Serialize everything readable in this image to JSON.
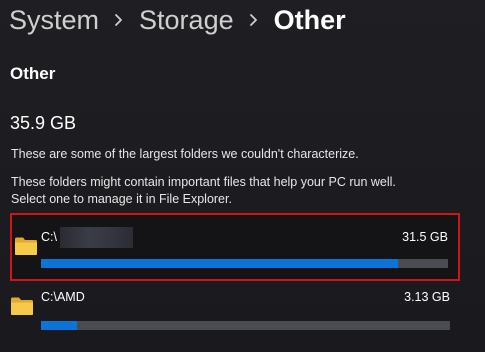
{
  "breadcrumb": {
    "items": [
      "System",
      "Storage",
      "Other"
    ]
  },
  "section": {
    "title": "Other",
    "total_size": "35.9 GB",
    "description": "These are some of the largest folders we couldn't characterize.",
    "help_line1": "These folders might contain important files that help your PC run well.",
    "help_line2": "Select one to manage it in File Explorer."
  },
  "folders": [
    {
      "path": "C:\\",
      "size": "31.5 GB",
      "usage_fraction": 0.877,
      "selected": true
    },
    {
      "path": "C:\\AMD",
      "size": "3.13 GB",
      "usage_fraction": 0.087,
      "selected": false
    }
  ],
  "colors": {
    "accent": "#0b74d9",
    "highlight_border": "#d01418",
    "folder_yellow": "#f5c94a"
  },
  "icons": {
    "chevron": "chevron-right-icon",
    "folder": "folder-icon"
  }
}
